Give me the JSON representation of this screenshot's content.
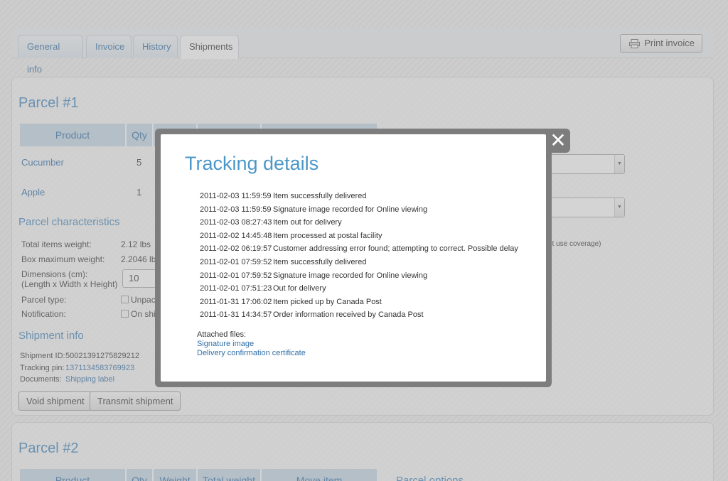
{
  "tabs": [
    {
      "label": "General info"
    },
    {
      "label": "Invoice"
    },
    {
      "label": "History"
    },
    {
      "label": "Shipments"
    }
  ],
  "print_invoice_label": "Print invoice",
  "parcel1": {
    "title": "Parcel #1",
    "table_headers": [
      "Product",
      "Qty",
      "",
      "",
      ""
    ],
    "rows": [
      {
        "product": "Cucumber",
        "qty": "5"
      },
      {
        "product": "Apple",
        "qty": "1"
      }
    ],
    "characteristics_title": "Parcel characteristics",
    "total_weight_label": "Total items weight:",
    "total_weight_value": "2.12 lbs",
    "box_max_label": "Box maximum weight:",
    "box_max_value": "2.2046 lb",
    "dimensions_label_1": "Dimensions (cm):",
    "dimensions_label_2": "(Length x Width x Height)",
    "dimensions_value": "10",
    "parcel_type_label": "Parcel type:",
    "parcel_type_option": "Unpac",
    "notification_label": "Notification:",
    "notification_option": "On shi",
    "coverage_fragment": "ot use coverage)",
    "shipment_info_title": "Shipment info",
    "shipment_id_label": "Shipment ID:",
    "shipment_id_value": "50021391275829212",
    "tracking_pin_label": "Tracking pin:",
    "tracking_pin_value": "1371134583769923",
    "documents_label": "Documents:",
    "documents_value": "Shipping label",
    "void_label": "Void shipment",
    "transmit_label": "Transmit shipment"
  },
  "parcel2": {
    "title": "Parcel #2",
    "table_headers": [
      "Product",
      "Qty",
      "Weight",
      "Total weight",
      "Move item"
    ],
    "options_fragment": "Parcel options"
  },
  "modal": {
    "title": "Tracking details",
    "close_glyph": "✕",
    "events": [
      {
        "ts": "2011-02-03 11:59:59",
        "desc": "Item successfully delivered"
      },
      {
        "ts": "2011-02-03 11:59:59",
        "desc": "Signature image recorded for Online viewing"
      },
      {
        "ts": "2011-02-03 08:27:43",
        "desc": "Item out for delivery"
      },
      {
        "ts": "2011-02-02 14:45:48",
        "desc": "Item processed at postal facility"
      },
      {
        "ts": "2011-02-02 06:19:57",
        "desc": "Customer addressing error found; attempting to correct. Possible delay"
      },
      {
        "ts": "2011-02-01 07:59:52",
        "desc": "Item successfully delivered"
      },
      {
        "ts": "2011-02-01 07:59:52",
        "desc": "Signature image recorded for Online viewing"
      },
      {
        "ts": "2011-02-01 07:51:23",
        "desc": "Out for delivery"
      },
      {
        "ts": "2011-01-31 17:06:02",
        "desc": "Item picked up by Canada Post"
      },
      {
        "ts": "2011-01-31 14:34:57",
        "desc": "Order information received by Canada Post"
      }
    ],
    "attached_label": "Attached files:",
    "attachments": [
      "Signature image",
      "Delivery confirmation certificate"
    ]
  }
}
